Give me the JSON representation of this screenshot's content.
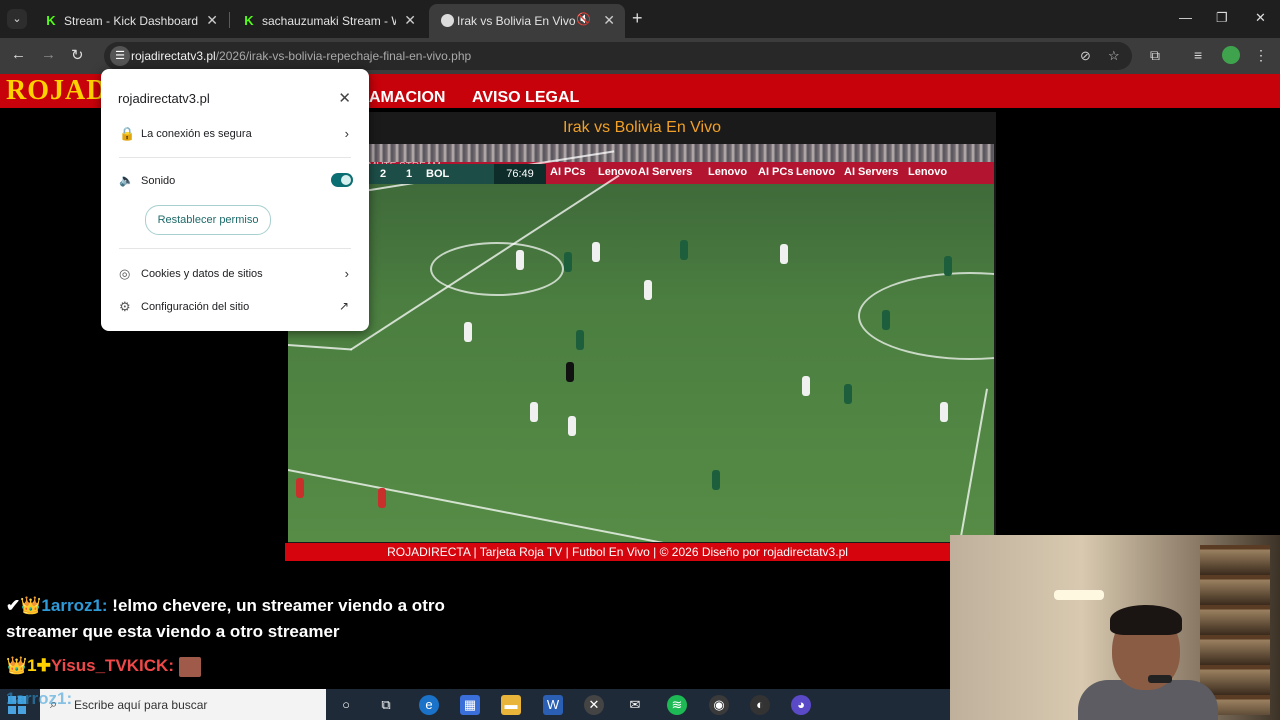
{
  "browser": {
    "tabs": [
      {
        "title": "Stream - Kick Dashboard",
        "favicon": "kick-icon"
      },
      {
        "title": "sachauzumaki Stream - Watch I",
        "favicon": "kick-icon"
      },
      {
        "title": "Irak vs Bolivia En Vivo | Rep",
        "favicon": "soccer-ball-icon"
      }
    ],
    "address": {
      "domain": "rojadirectatv3.pl",
      "path": "/2026/irak-vs-bolivia-repechaje-final-en-vivo.php"
    }
  },
  "site": {
    "logo": "ROJADI",
    "nav": [
      "AMACION",
      "AVISO LEGAL"
    ],
    "player_title": "Irak vs Bolivia En Vivo",
    "footer": "ROJADIRECTA | Tarjeta Roja TV | Futbol En Vivo | © 2026 Diseño por rojadirectatv3.pl"
  },
  "video": {
    "mute_label": "MUTE STREAM",
    "score_home": "2",
    "score_away": "1",
    "team_away": "BOL",
    "clock": "76:49",
    "ads": [
      "AI PCs",
      "Lenovo",
      "AI Servers",
      "Lenovo",
      "AI PCs",
      "Lenovo",
      "AI Servers",
      "Lenovo"
    ]
  },
  "site_info_popup": {
    "site": "rojadirectatv3.pl",
    "connection": "La conexión es segura",
    "sound_label": "Sonido",
    "sound_enabled": true,
    "reset_button": "Restablecer permiso",
    "cookies": "Cookies y datos de sitios",
    "settings": "Configuración del sitio"
  },
  "chat": [
    {
      "user": "1arroz1:",
      "message": "!elmo chevere, un streamer viendo a otro",
      "badges": "✔👑"
    },
    {
      "user": "",
      "message": "streamer que esta viendo a otro streamer",
      "badges": ""
    },
    {
      "user": "Yisus_TVKICK:",
      "message": "",
      "badges": "👑1✚"
    },
    {
      "user": "1arroz1:",
      "message": "",
      "badges": ""
    }
  ],
  "taskbar": {
    "search_placeholder": "Escribe aquí para buscar"
  }
}
